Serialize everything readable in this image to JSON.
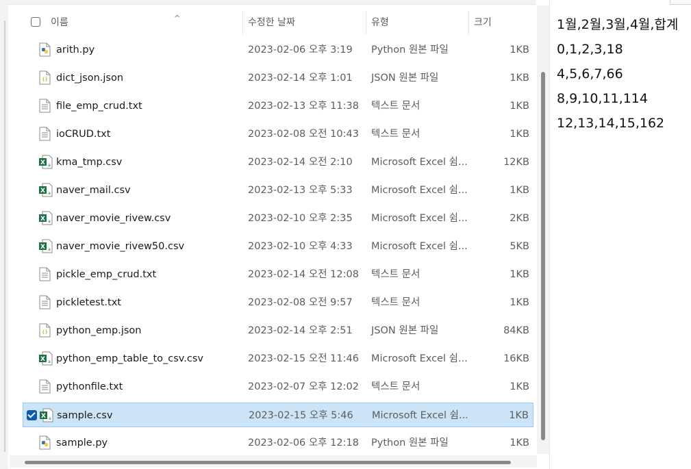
{
  "header": {
    "name": "이름",
    "date": "수정한 날짜",
    "type": "유형",
    "size": "크기",
    "sort_glyph": "^"
  },
  "files": [
    {
      "name": "arith.py",
      "date": "2023-02-06 오후 3:19",
      "type": "Python 원본 파일",
      "size": "1KB",
      "icon": "python-file-icon"
    },
    {
      "name": "dict_json.json",
      "date": "2023-02-14 오후 1:01",
      "type": "JSON 원본 파일",
      "size": "1KB",
      "icon": "json-file-icon"
    },
    {
      "name": "file_emp_crud.txt",
      "date": "2023-02-13 오후 11:38",
      "type": "텍스트 문서",
      "size": "1KB",
      "icon": "text-file-icon"
    },
    {
      "name": "ioCRUD.txt",
      "date": "2023-02-08 오전 10:43",
      "type": "텍스트 문서",
      "size": "1KB",
      "icon": "text-file-icon"
    },
    {
      "name": "kma_tmp.csv",
      "date": "2023-02-14 오전 2:10",
      "type": "Microsoft Excel 쉼...",
      "size": "12KB",
      "icon": "excel-file-icon"
    },
    {
      "name": "naver_mail.csv",
      "date": "2023-02-13 오후 5:33",
      "type": "Microsoft Excel 쉼...",
      "size": "1KB",
      "icon": "excel-file-icon"
    },
    {
      "name": "naver_movie_rivew.csv",
      "date": "2023-02-10 오후 2:35",
      "type": "Microsoft Excel 쉼...",
      "size": "2KB",
      "icon": "excel-file-icon"
    },
    {
      "name": "naver_movie_rivew50.csv",
      "date": "2023-02-10 오후 4:33",
      "type": "Microsoft Excel 쉼...",
      "size": "5KB",
      "icon": "excel-file-icon"
    },
    {
      "name": "pickle_emp_crud.txt",
      "date": "2023-02-14 오전 12:08",
      "type": "텍스트 문서",
      "size": "1KB",
      "icon": "text-file-icon"
    },
    {
      "name": "pickletest.txt",
      "date": "2023-02-08 오전 9:57",
      "type": "텍스트 문서",
      "size": "1KB",
      "icon": "text-file-icon"
    },
    {
      "name": "python_emp.json",
      "date": "2023-02-14 오후 2:51",
      "type": "JSON 원본 파일",
      "size": "84KB",
      "icon": "json-file-icon"
    },
    {
      "name": "python_emp_table_to_csv.csv",
      "date": "2023-02-15 오전 11:46",
      "type": "Microsoft Excel 쉼...",
      "size": "16KB",
      "icon": "excel-file-icon"
    },
    {
      "name": "pythonfile.txt",
      "date": "2023-02-07 오후 12:02",
      "type": "텍스트 문서",
      "size": "1KB",
      "icon": "text-file-icon"
    },
    {
      "name": "sample.csv",
      "date": "2023-02-15 오후 5:46",
      "type": "Microsoft Excel 쉼...",
      "size": "1KB",
      "icon": "excel-file-icon",
      "selected": true
    },
    {
      "name": "sample.py",
      "date": "2023-02-06 오후 12:18",
      "type": "Python 원본 파일",
      "size": "1KB",
      "icon": "python-file-icon"
    }
  ],
  "preview": {
    "lines": [
      "1월,2월,3월,4월,합계",
      "0,1,2,3,18",
      "4,5,6,7,66",
      "8,9,10,11,114",
      "12,13,14,15,162"
    ]
  },
  "colors": {
    "selected_bg": "#cce4f7",
    "selected_border": "#99c9ef",
    "excel_green": "#1d7044",
    "python_blue": "#3776ab"
  }
}
